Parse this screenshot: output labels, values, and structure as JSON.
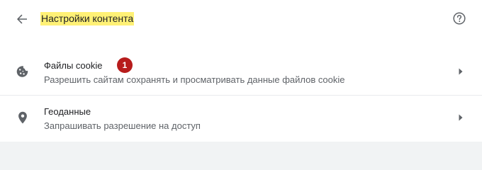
{
  "header": {
    "title": "Настройки контента",
    "back_icon": "arrow-back-icon",
    "help_icon": "help-circle-icon"
  },
  "settings": [
    {
      "title": "Файлы cookie",
      "subtitle": "Разрешить сайтам сохранять и просматривать данные файлов cookie",
      "icon": "cookie-icon"
    },
    {
      "title": "Геоданные",
      "subtitle": "Запрашивать разрешение на доступ",
      "icon": "location-pin-icon"
    }
  ],
  "annotation_badge": "1",
  "colors": {
    "highlight": "#fff176",
    "badge": "#b71c1c",
    "icon": "#5f6368",
    "text_primary": "#202124",
    "text_secondary": "#5f6368"
  }
}
